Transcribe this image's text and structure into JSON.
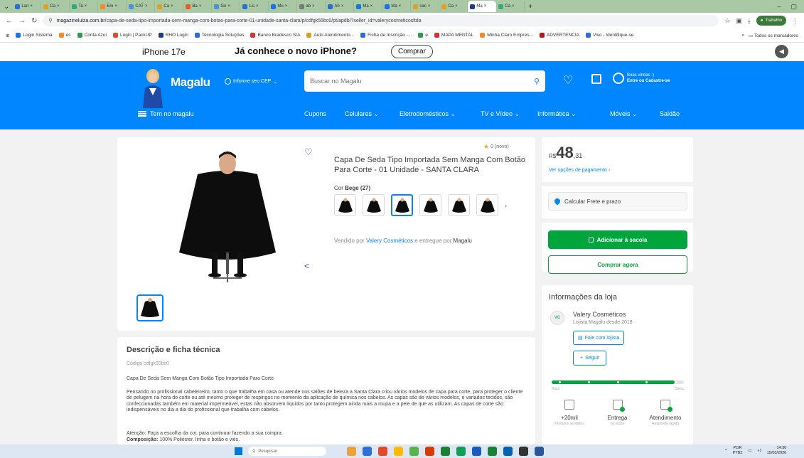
{
  "browser": {
    "tabs": [
      "Lan",
      "Ca",
      "Ta",
      "Em",
      "CAT",
      "Ca",
      "Ba",
      "Go",
      "Lis",
      "Mu",
      "ab",
      "Ah",
      "Ma",
      "Ma",
      "sac",
      "Ca",
      "Ma",
      "Ca"
    ],
    "active_tab_index": 16,
    "url_host": "magazineluiza.com.br",
    "url_path": "/capa-de-seda-tipo-importada-sem-manga-com-botao-para-corte-01-unidade-santa-clara/p/cdfgk55bc0/pt/apdb/?seller_id=valerycosmeticosltda",
    "profile_label": "Trabalho",
    "bookmarks": [
      "Login Sistema",
      "es",
      "Conta Azul",
      "Login | PackUP",
      "RHO Login",
      "Tecnologia Soluções",
      "Banco Bradesco S/A",
      "Auto Atendimento...",
      "Ficha de Inscrição -...",
      "e",
      "MAPA MENTAL",
      "Minha Claro Empres...",
      "ADVERTENCIA",
      "Vivo - Identifique-se"
    ],
    "other_bookmarks": "Todos os marcadores"
  },
  "promo": {
    "device": "iPhone 17e",
    "question": "Já conhece o novo iPhone?",
    "button": "Comprar"
  },
  "header": {
    "logo": "Magalu",
    "cep": "Informe seu CEP",
    "search_placeholder": "Buscar no Magalu",
    "greeting": "Boas vindas :)",
    "login": "Entre ou Cadastre-se",
    "menu": "Tem no magalu",
    "categories": [
      "Cupons",
      "Celulares ⌄",
      "Eletrodomésticos ⌄",
      "TV e Vídeo ⌄",
      "Informática ⌄",
      "Móveis ⌄",
      "Saldão"
    ]
  },
  "product": {
    "rating": "0 (novo)",
    "title": "Capa De Seda Tipo Importada Sem Manga Com Botão Para Corte - 01 Unidade - SANTA CLARA",
    "color_label": "Cor",
    "color_value": "Bege (27)",
    "swatch_count": 6,
    "selected_swatch": 2,
    "sold_by": "Vendido por",
    "seller": "Valery Cosméticos",
    "delivered_by": "e entregue por",
    "deliverer": "Magalu"
  },
  "buy": {
    "currency": "R$",
    "price_int": "48",
    "price_cents": ",31",
    "payment_link": "Ver opções de pagamento",
    "freight": "Calcular Frete e prazo",
    "add_to_bag": "Adicionar à sacola",
    "buy_now": "Comprar agora"
  },
  "store": {
    "heading": "Informações da loja",
    "name": "Valery Cosméticos",
    "since": "Lojista Magalu desde 2018",
    "chat": "Fale com lojista",
    "follow": "Seguir",
    "reputation_fraction": 0.93,
    "scale_low": "Ruim",
    "scale_high": "Ótimo",
    "metrics": [
      {
        "value": "+20mil",
        "label": "Produtos vendidos"
      },
      {
        "value": "Entrega",
        "label": "no prazo"
      },
      {
        "value": "Atendimento",
        "label": "Responde rápido"
      }
    ]
  },
  "description": {
    "heading": "Descrição e ficha técnica",
    "code": "Código cdfgk55bc0",
    "subtitle": "Capa De Seda Sem Manga Com Botão Tipo Importada Para Corte",
    "body": "Pensando no profissional cabeleireiro, tanto o que trabalha em casa ou atende nos salões de beleza a Santa Clara criou vários modelos de capa para corte, para proteger o cliente de pelugem na hora do corte ou até mesmo proteger de respingos no momento da aplicação de química nos cabelos. As capas são de vários modelos, e variados tecidos, são confeccionadas também em material impermeável, estas não absorvem líquidos por tanto protegem ainda mais a roupa e a pele de que as utilizam. As capas de corte são indispensáveis no dia a dia do profissional que trabalha com cabelos.",
    "attention": "Atenção: Faça a escolha da cor, para continuar fazendo a sua compra.",
    "composition_label": "Composição:",
    "composition": "100% Poliéster, linha e botão e viés."
  },
  "taskbar": {
    "search": "Pesquisar",
    "lang": "POR",
    "lang2": "PTB2",
    "time": "14:30",
    "date": "15/03/2026"
  }
}
